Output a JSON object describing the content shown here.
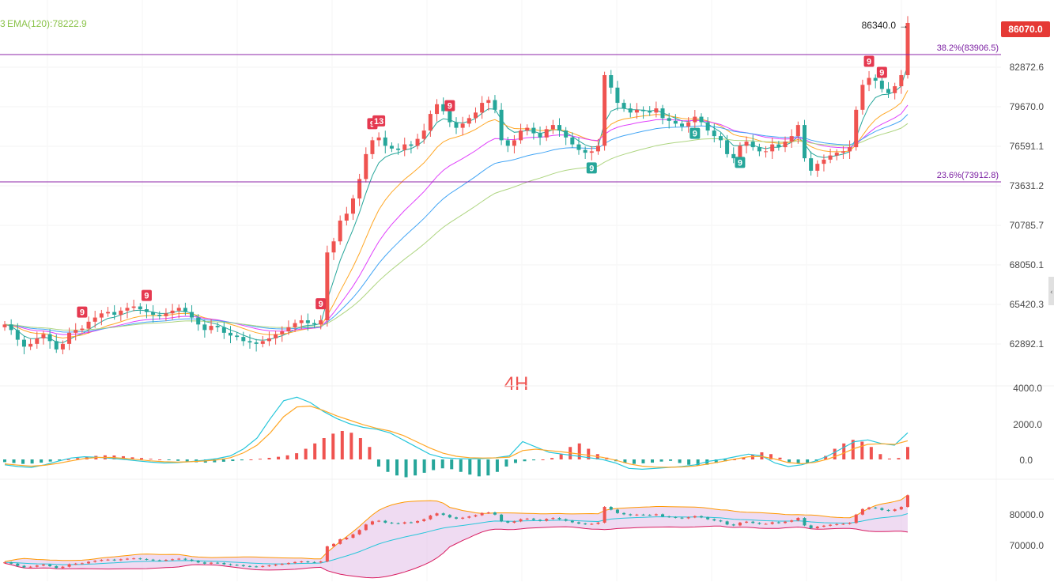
{
  "chart_data": [
    {
      "type": "candlestick",
      "timeframe": "4H",
      "legend": {
        "ema_label": "EMA(120):78222.9"
      },
      "last_price": "86070.0",
      "high_label": "86340.0",
      "ylim": [
        61500,
        87000
      ],
      "y_ticks": [
        "82872.6",
        "79670.0",
        "76591.1",
        "73631.2",
        "70785.7",
        "68050.1",
        "65420.3",
        "62892.1"
      ],
      "fib_levels": [
        {
          "label": "38.2%(83906.5)",
          "value": 83906.5
        },
        {
          "label": "23.6%(73912.8)",
          "value": 73912.8
        }
      ],
      "close_series_approx": [
        64300,
        63900,
        63200,
        62700,
        62900,
        63300,
        63600,
        63100,
        62500,
        62900,
        63700,
        63900,
        64000,
        64500,
        64800,
        65100,
        65200,
        65000,
        65300,
        65500,
        65600,
        65400,
        65200,
        65000,
        64900,
        65100,
        65300,
        65500,
        65200,
        64800,
        64300,
        63900,
        64200,
        64100,
        63700,
        63500,
        63400,
        63100,
        63000,
        62900,
        63100,
        63300,
        63600,
        63800,
        64100,
        64400,
        64600,
        64400,
        64300,
        64600,
        69500,
        70300,
        71800,
        72300,
        73400,
        74800,
        76600,
        77600,
        77800,
        77200,
        77000,
        76900,
        77300,
        77200,
        77700,
        78300,
        79500,
        80200,
        79700,
        78900,
        78500,
        78800,
        79200,
        79600,
        80300,
        80500,
        79800,
        77600,
        77200,
        77600,
        78300,
        78500,
        78100,
        77800,
        78400,
        78700,
        78300,
        77800,
        77300,
        76900,
        76700,
        76800,
        77200,
        82300,
        81400,
        80300,
        79900,
        79600,
        79800,
        79700,
        79600,
        79900,
        79200,
        79000,
        78800,
        78600,
        78900,
        79300,
        78900,
        78300,
        77900,
        77600,
        76600,
        76300,
        77200,
        77500,
        77100,
        76800,
        76800,
        77300,
        77100,
        77500,
        77900,
        78700,
        76300,
        75400,
        75900,
        76200,
        76500,
        76700,
        76800,
        77100,
        79800,
        81600,
        82100,
        81900,
        81300,
        81000,
        81500,
        82300,
        86070
      ],
      "ema_fast_approx": "teal line following price closely",
      "ema_ribbon": [
        "teal",
        "orange",
        "magenta",
        "blue",
        "light-green"
      ],
      "td_marks": [
        {
          "text": "9",
          "color": "red",
          "pos": "above"
        },
        {
          "text": "9",
          "color": "red",
          "pos": "above"
        },
        {
          "text": "9",
          "color": "red",
          "pos": "above"
        },
        {
          "text": "9",
          "color": "red",
          "pos": "above"
        },
        {
          "text": "13",
          "color": "red",
          "pos": "above"
        },
        {
          "text": "9",
          "color": "red",
          "pos": "above"
        },
        {
          "text": "9",
          "color": "green",
          "pos": "below"
        },
        {
          "text": "9",
          "color": "green",
          "pos": "below"
        },
        {
          "text": "9",
          "color": "green",
          "pos": "below"
        },
        {
          "text": "9",
          "color": "red",
          "pos": "above"
        },
        {
          "text": "9",
          "color": "red",
          "pos": "above"
        }
      ]
    },
    {
      "type": "macd",
      "ylim": [
        -2200,
        4200
      ],
      "y_ticks": [
        "4000.0",
        "2000.0",
        "0.0"
      ],
      "histogram_approx": [
        -150,
        -200,
        -250,
        -230,
        -180,
        -120,
        -60,
        0,
        80,
        150,
        200,
        230,
        220,
        180,
        120,
        80,
        40,
        0,
        -40,
        -80,
        -120,
        -160,
        -180,
        -160,
        -130,
        -90,
        -50,
        0,
        40,
        90,
        150,
        230,
        350,
        600,
        900,
        1200,
        1450,
        1600,
        1500,
        1200,
        700,
        -400,
        -700,
        -900,
        -1000,
        -900,
        -750,
        -600,
        -500,
        -550,
        -700,
        -850,
        -950,
        -900,
        -700,
        -400,
        -200,
        -100,
        -50,
        0,
        80,
        300,
        700,
        900,
        600,
        300,
        100,
        -100,
        -200,
        -250,
        -220,
        -180,
        -120,
        -80,
        -200,
        -300,
        -350,
        -300,
        -200,
        -100,
        0,
        100,
        250,
        400,
        300,
        100,
        -150,
        -250,
        -200,
        -100,
        200,
        600,
        900,
        1100,
        1000,
        700,
        300,
        50,
        80,
        700
      ],
      "macd_line_approx": [
        -300,
        -400,
        -450,
        -300,
        -100,
        80,
        150,
        120,
        60,
        0,
        -80,
        -150,
        -200,
        -180,
        -120,
        -50,
        50,
        200,
        600,
        1200,
        2300,
        3300,
        3500,
        3200,
        2700,
        2300,
        2000,
        1800,
        1700,
        1500,
        1100,
        700,
        300,
        100,
        50,
        30,
        50,
        100,
        200,
        1000,
        700,
        400,
        300,
        200,
        100,
        0,
        -200,
        -500,
        -550,
        -500,
        -450,
        -400,
        -300,
        -100,
        0,
        150,
        300,
        200,
        -200,
        -400,
        -300,
        -100,
        200,
        600,
        1000,
        1100,
        900,
        800,
        1500
      ],
      "signal_line_approx": [
        -250,
        -320,
        -380,
        -330,
        -220,
        -80,
        50,
        110,
        110,
        60,
        -10,
        -80,
        -130,
        -150,
        -130,
        -90,
        -20,
        100,
        380,
        800,
        1500,
        2400,
        2950,
        3000,
        2750,
        2450,
        2200,
        1950,
        1750,
        1600,
        1350,
        1000,
        650,
        350,
        180,
        100,
        80,
        90,
        130,
        500,
        580,
        500,
        420,
        330,
        230,
        120,
        -40,
        -250,
        -380,
        -430,
        -440,
        -420,
        -370,
        -250,
        -120,
        20,
        150,
        170,
        20,
        -180,
        -240,
        -170,
        20,
        300,
        620,
        850,
        880,
        850,
        1050
      ]
    },
    {
      "type": "bollinger_candles",
      "ylim": [
        66500,
        84000
      ],
      "y_ticks": [
        "80000.0",
        "70000.0"
      ]
    }
  ]
}
